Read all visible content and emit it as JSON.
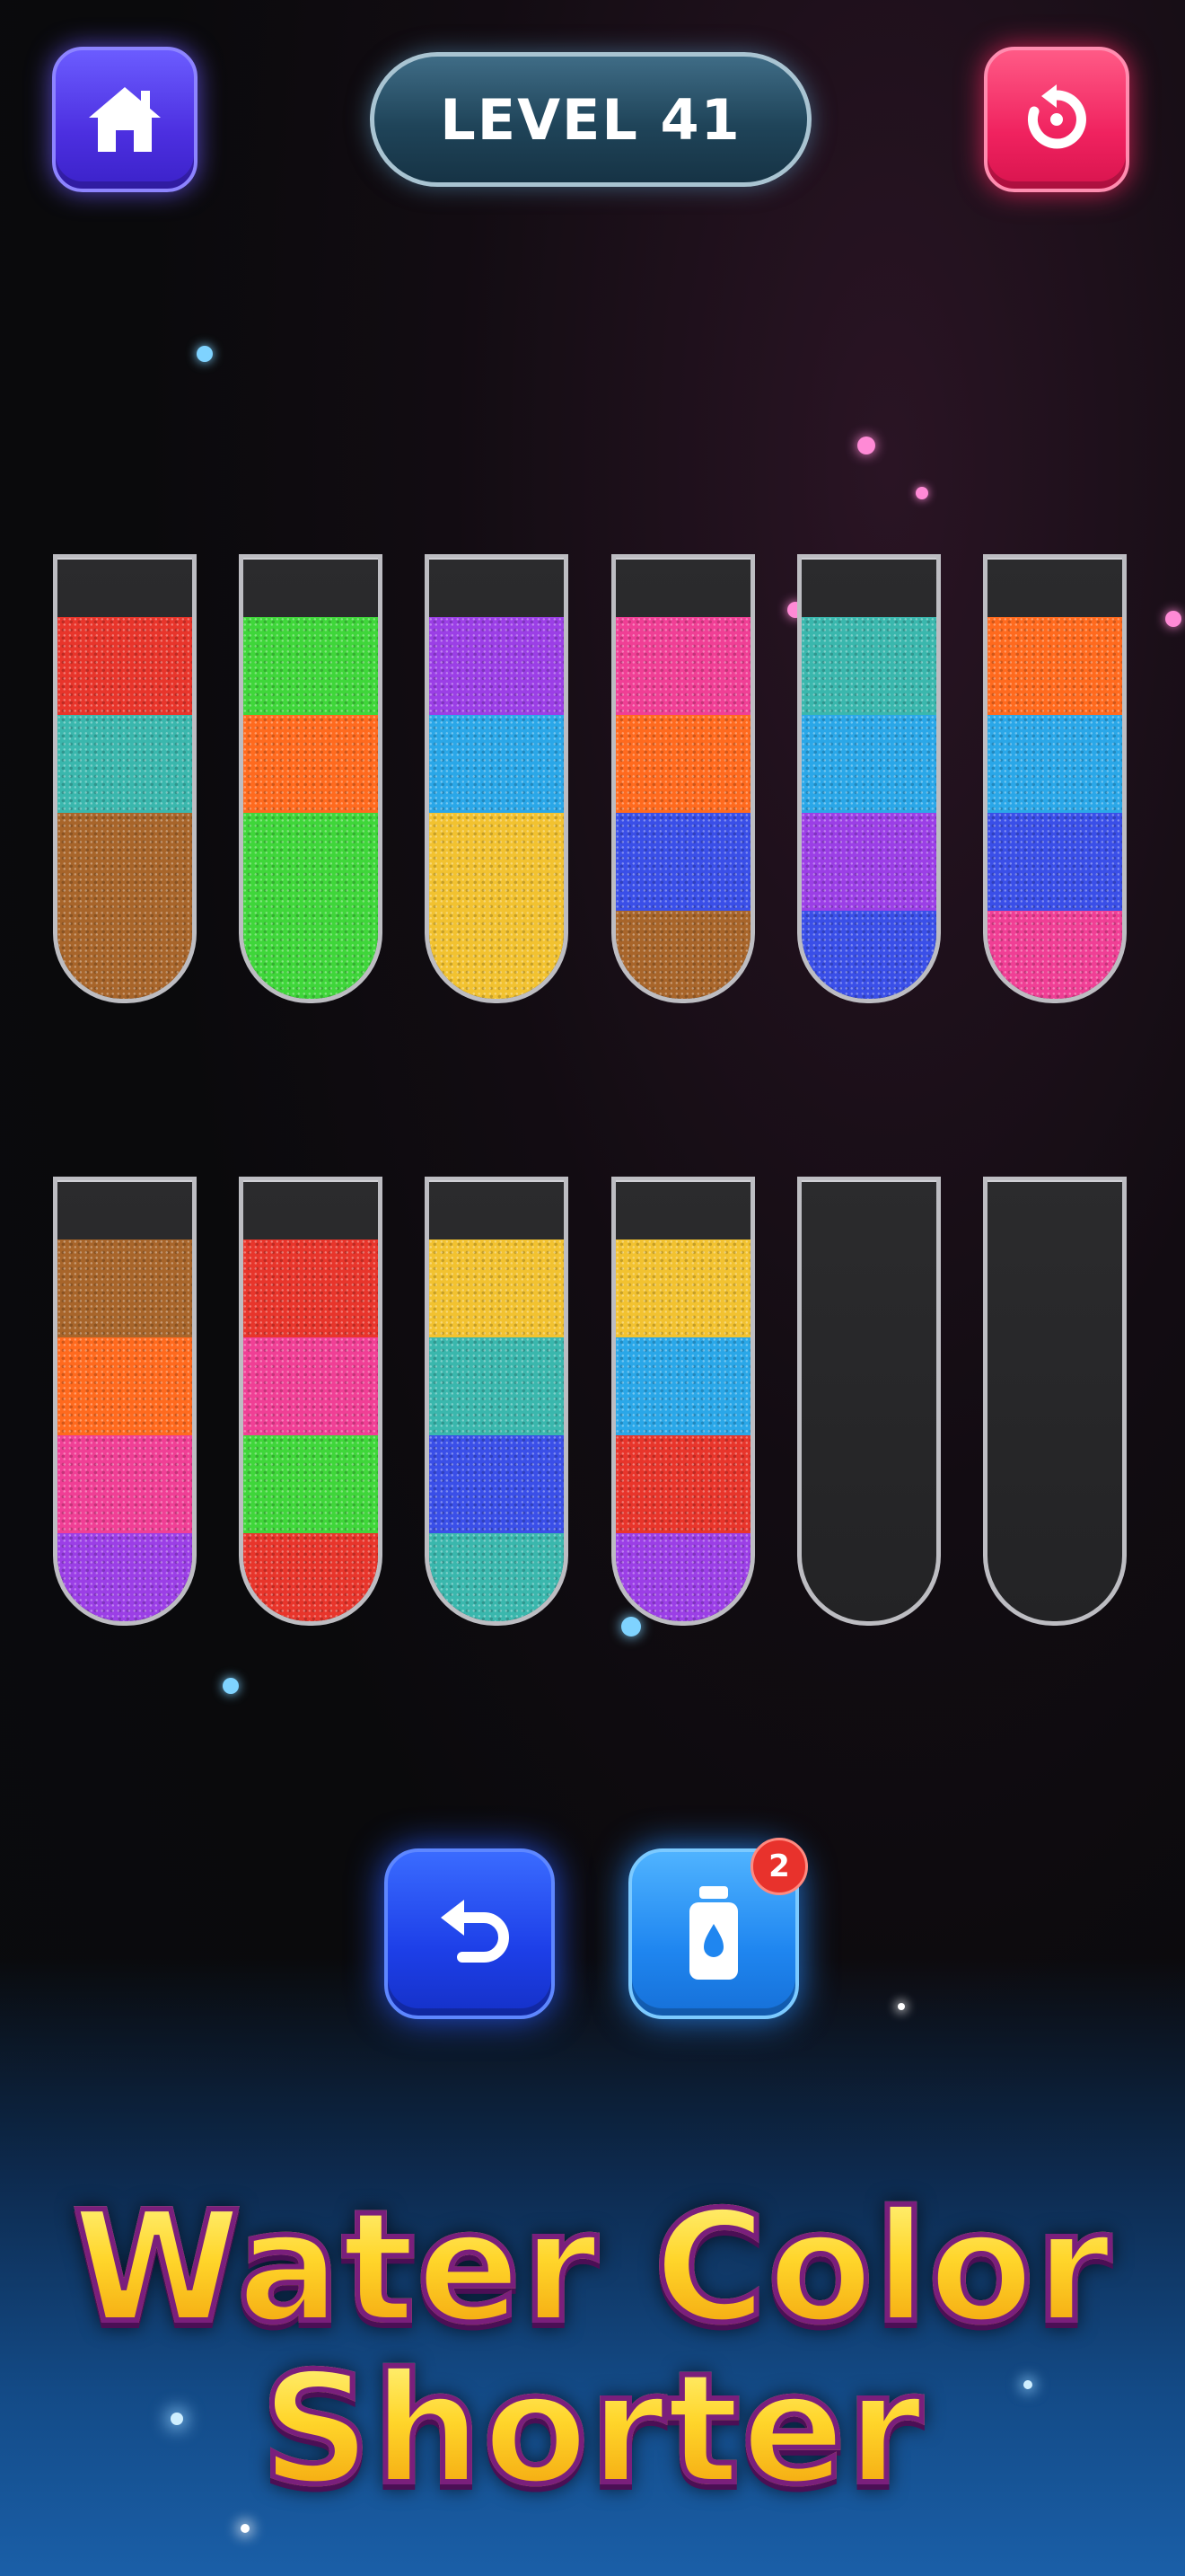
{
  "header": {
    "level_label": "LEVEL 41",
    "home_icon": "home-icon",
    "restart_icon": "restart-icon"
  },
  "colors": {
    "red": "#e8352b",
    "teal": "#3ab7ad",
    "brown": "#a8652a",
    "green": "#3fd63a",
    "orange": "#ff6a1e",
    "purple": "#9b3fe6",
    "skyblue": "#2aa7e8",
    "yellow": "#f2c230",
    "pink": "#f03f95",
    "blue": "#3a4fe8"
  },
  "tubes": [
    {
      "layers": [
        "red",
        "teal",
        "brown",
        "brown"
      ]
    },
    {
      "layers": [
        "green",
        "orange",
        "green",
        "green"
      ]
    },
    {
      "layers": [
        "purple",
        "skyblue",
        "yellow",
        "yellow"
      ]
    },
    {
      "layers": [
        "pink",
        "orange",
        "blue",
        "brown"
      ]
    },
    {
      "layers": [
        "teal",
        "skyblue",
        "purple",
        "blue"
      ]
    },
    {
      "layers": [
        "orange",
        "skyblue",
        "blue",
        "pink"
      ]
    },
    {
      "layers": [
        "brown",
        "orange",
        "pink",
        "purple"
      ]
    },
    {
      "layers": [
        "red",
        "pink",
        "green",
        "red"
      ]
    },
    {
      "layers": [
        "yellow",
        "teal",
        "blue",
        "teal"
      ]
    },
    {
      "layers": [
        "yellow",
        "skyblue",
        "red",
        "purple"
      ]
    },
    {
      "layers": []
    },
    {
      "layers": []
    }
  ],
  "controls": {
    "undo_icon": "undo-icon",
    "add_tube_icon": "add-tube-icon",
    "add_tube_count": "2"
  },
  "title": {
    "line1": "Water Color",
    "line2": "Shorter"
  }
}
